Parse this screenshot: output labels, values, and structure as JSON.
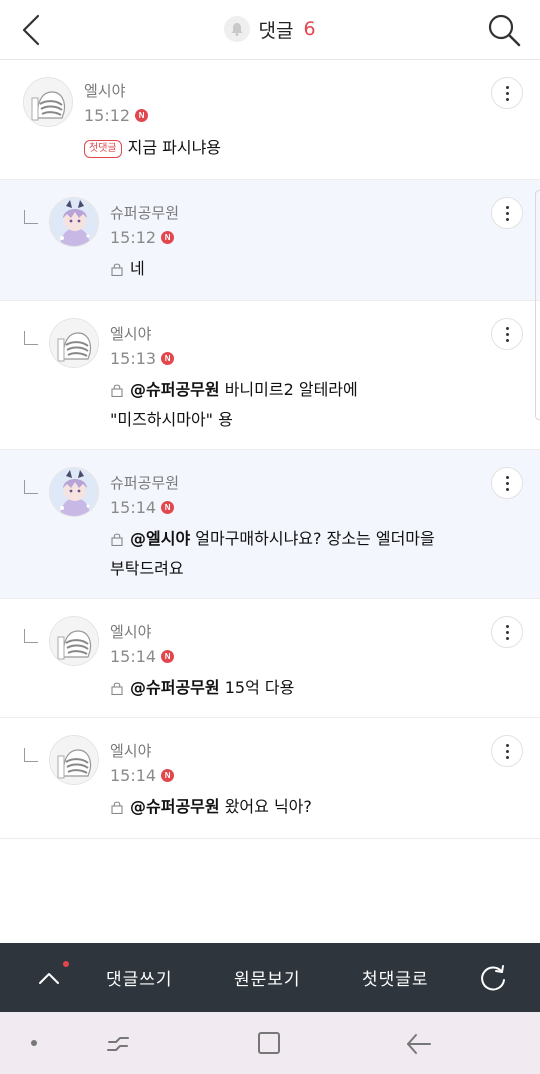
{
  "header": {
    "title": "댓글",
    "count": "6",
    "back_icon": "chevron-left-icon",
    "bell_icon": "bell-icon",
    "search_icon": "search-icon"
  },
  "comments": [
    {
      "nickname": "엘시야",
      "time": "15:12",
      "new_badge": "N",
      "first_badge": "첫댓글",
      "text": "지금 파시냐용",
      "is_reply": false,
      "highlight": false,
      "avatar": "ghost-avatar"
    },
    {
      "nickname": "슈퍼공무원",
      "time": "15:12",
      "new_badge": "N",
      "text": "네",
      "is_reply": true,
      "highlight": true,
      "avatar": "anime-avatar"
    },
    {
      "nickname": "엘시야",
      "time": "15:13",
      "new_badge": "N",
      "mention": "@슈퍼공무원",
      "text_line1": "바니미르2 알테라에",
      "text_line2": "\"미즈하시마아\" 용",
      "is_reply": true,
      "highlight": false,
      "avatar": "ghost-avatar"
    },
    {
      "nickname": "슈퍼공무원",
      "time": "15:14",
      "new_badge": "N",
      "mention": "@엘시야",
      "text_line1": "얼마구매하시냐요? 장소는 엘더마을",
      "text_line2": "부탁드려요",
      "is_reply": true,
      "highlight": true,
      "avatar": "anime-avatar"
    },
    {
      "nickname": "엘시야",
      "time": "15:14",
      "new_badge": "N",
      "mention": "@슈퍼공무원",
      "text": "15억 다용",
      "is_reply": true,
      "highlight": false,
      "avatar": "ghost-avatar"
    },
    {
      "nickname": "엘시야",
      "time": "15:14",
      "new_badge": "N",
      "mention": "@슈퍼공무원",
      "text": "왔어요 닉아?",
      "is_reply": true,
      "highlight": false,
      "avatar": "ghost-avatar"
    }
  ],
  "toolbar": {
    "up_icon": "chevron-up-icon",
    "write_label": "댓글쓰기",
    "original_label": "원문보기",
    "first_label": "첫댓글로",
    "refresh_icon": "refresh-icon"
  },
  "system_nav": {
    "recent_icon": "recent-apps-icon",
    "home_icon": "home-icon",
    "back_icon": "back-arrow-icon"
  },
  "colors": {
    "accent": "#e2474e",
    "toolbar_bg": "#2f353d",
    "highlight_bg": "#f3f6fd",
    "sysnav_bg": "#f1eaf0"
  }
}
